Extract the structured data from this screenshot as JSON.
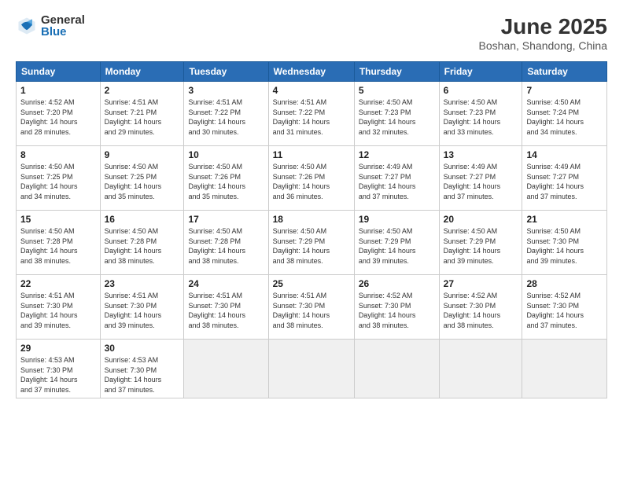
{
  "logo": {
    "general": "General",
    "blue": "Blue"
  },
  "title": "June 2025",
  "subtitle": "Boshan, Shandong, China",
  "days_of_week": [
    "Sunday",
    "Monday",
    "Tuesday",
    "Wednesday",
    "Thursday",
    "Friday",
    "Saturday"
  ],
  "weeks": [
    [
      {
        "day": "1",
        "info": "Sunrise: 4:52 AM\nSunset: 7:20 PM\nDaylight: 14 hours\nand 28 minutes."
      },
      {
        "day": "2",
        "info": "Sunrise: 4:51 AM\nSunset: 7:21 PM\nDaylight: 14 hours\nand 29 minutes."
      },
      {
        "day": "3",
        "info": "Sunrise: 4:51 AM\nSunset: 7:22 PM\nDaylight: 14 hours\nand 30 minutes."
      },
      {
        "day": "4",
        "info": "Sunrise: 4:51 AM\nSunset: 7:22 PM\nDaylight: 14 hours\nand 31 minutes."
      },
      {
        "day": "5",
        "info": "Sunrise: 4:50 AM\nSunset: 7:23 PM\nDaylight: 14 hours\nand 32 minutes."
      },
      {
        "day": "6",
        "info": "Sunrise: 4:50 AM\nSunset: 7:23 PM\nDaylight: 14 hours\nand 33 minutes."
      },
      {
        "day": "7",
        "info": "Sunrise: 4:50 AM\nSunset: 7:24 PM\nDaylight: 14 hours\nand 34 minutes."
      }
    ],
    [
      {
        "day": "8",
        "info": "Sunrise: 4:50 AM\nSunset: 7:25 PM\nDaylight: 14 hours\nand 34 minutes."
      },
      {
        "day": "9",
        "info": "Sunrise: 4:50 AM\nSunset: 7:25 PM\nDaylight: 14 hours\nand 35 minutes."
      },
      {
        "day": "10",
        "info": "Sunrise: 4:50 AM\nSunset: 7:26 PM\nDaylight: 14 hours\nand 35 minutes."
      },
      {
        "day": "11",
        "info": "Sunrise: 4:50 AM\nSunset: 7:26 PM\nDaylight: 14 hours\nand 36 minutes."
      },
      {
        "day": "12",
        "info": "Sunrise: 4:49 AM\nSunset: 7:27 PM\nDaylight: 14 hours\nand 37 minutes."
      },
      {
        "day": "13",
        "info": "Sunrise: 4:49 AM\nSunset: 7:27 PM\nDaylight: 14 hours\nand 37 minutes."
      },
      {
        "day": "14",
        "info": "Sunrise: 4:49 AM\nSunset: 7:27 PM\nDaylight: 14 hours\nand 37 minutes."
      }
    ],
    [
      {
        "day": "15",
        "info": "Sunrise: 4:50 AM\nSunset: 7:28 PM\nDaylight: 14 hours\nand 38 minutes."
      },
      {
        "day": "16",
        "info": "Sunrise: 4:50 AM\nSunset: 7:28 PM\nDaylight: 14 hours\nand 38 minutes."
      },
      {
        "day": "17",
        "info": "Sunrise: 4:50 AM\nSunset: 7:28 PM\nDaylight: 14 hours\nand 38 minutes."
      },
      {
        "day": "18",
        "info": "Sunrise: 4:50 AM\nSunset: 7:29 PM\nDaylight: 14 hours\nand 38 minutes."
      },
      {
        "day": "19",
        "info": "Sunrise: 4:50 AM\nSunset: 7:29 PM\nDaylight: 14 hours\nand 39 minutes."
      },
      {
        "day": "20",
        "info": "Sunrise: 4:50 AM\nSunset: 7:29 PM\nDaylight: 14 hours\nand 39 minutes."
      },
      {
        "day": "21",
        "info": "Sunrise: 4:50 AM\nSunset: 7:30 PM\nDaylight: 14 hours\nand 39 minutes."
      }
    ],
    [
      {
        "day": "22",
        "info": "Sunrise: 4:51 AM\nSunset: 7:30 PM\nDaylight: 14 hours\nand 39 minutes."
      },
      {
        "day": "23",
        "info": "Sunrise: 4:51 AM\nSunset: 7:30 PM\nDaylight: 14 hours\nand 39 minutes."
      },
      {
        "day": "24",
        "info": "Sunrise: 4:51 AM\nSunset: 7:30 PM\nDaylight: 14 hours\nand 38 minutes."
      },
      {
        "day": "25",
        "info": "Sunrise: 4:51 AM\nSunset: 7:30 PM\nDaylight: 14 hours\nand 38 minutes."
      },
      {
        "day": "26",
        "info": "Sunrise: 4:52 AM\nSunset: 7:30 PM\nDaylight: 14 hours\nand 38 minutes."
      },
      {
        "day": "27",
        "info": "Sunrise: 4:52 AM\nSunset: 7:30 PM\nDaylight: 14 hours\nand 38 minutes."
      },
      {
        "day": "28",
        "info": "Sunrise: 4:52 AM\nSunset: 7:30 PM\nDaylight: 14 hours\nand 37 minutes."
      }
    ],
    [
      {
        "day": "29",
        "info": "Sunrise: 4:53 AM\nSunset: 7:30 PM\nDaylight: 14 hours\nand 37 minutes."
      },
      {
        "day": "30",
        "info": "Sunrise: 4:53 AM\nSunset: 7:30 PM\nDaylight: 14 hours\nand 37 minutes."
      },
      null,
      null,
      null,
      null,
      null
    ]
  ]
}
